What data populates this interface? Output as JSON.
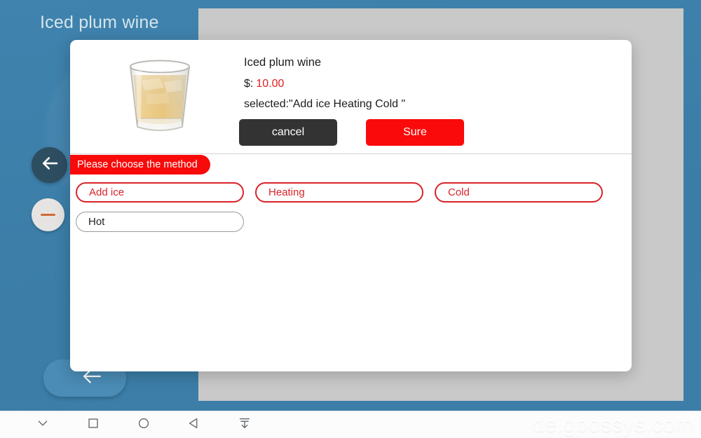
{
  "app": {
    "screen_title": "Iced plum wine",
    "background_color": "#3d80ab",
    "panel_color": "#c9c9c9"
  },
  "floating_controls": {
    "back_button_label": "back-arrow",
    "minus_button_label": "minus",
    "bottom_back_label": "back-arrow"
  },
  "dialog": {
    "product_name": "Iced plum wine",
    "price_label": "$:",
    "price_value": "10.00",
    "selected_text": "selected:\"Add ice Heating Cold \"",
    "cancel_label": "cancel",
    "sure_label": "Sure",
    "section_badge": "Please choose the method",
    "accent_red": "#fa0a0a",
    "cancel_bg": "#333333",
    "options": [
      {
        "label": "Add ice",
        "selected": true
      },
      {
        "label": "Heating",
        "selected": true
      },
      {
        "label": "Cold",
        "selected": true
      },
      {
        "label": "Hot",
        "selected": false
      }
    ]
  },
  "navbar": {
    "items": [
      {
        "icon": "chevron-down-icon"
      },
      {
        "icon": "square-icon"
      },
      {
        "icon": "circle-icon"
      },
      {
        "icon": "triangle-back-icon"
      },
      {
        "icon": "collapse-down-icon"
      }
    ]
  },
  "watermark": {
    "text": "de.gpossys.com"
  }
}
